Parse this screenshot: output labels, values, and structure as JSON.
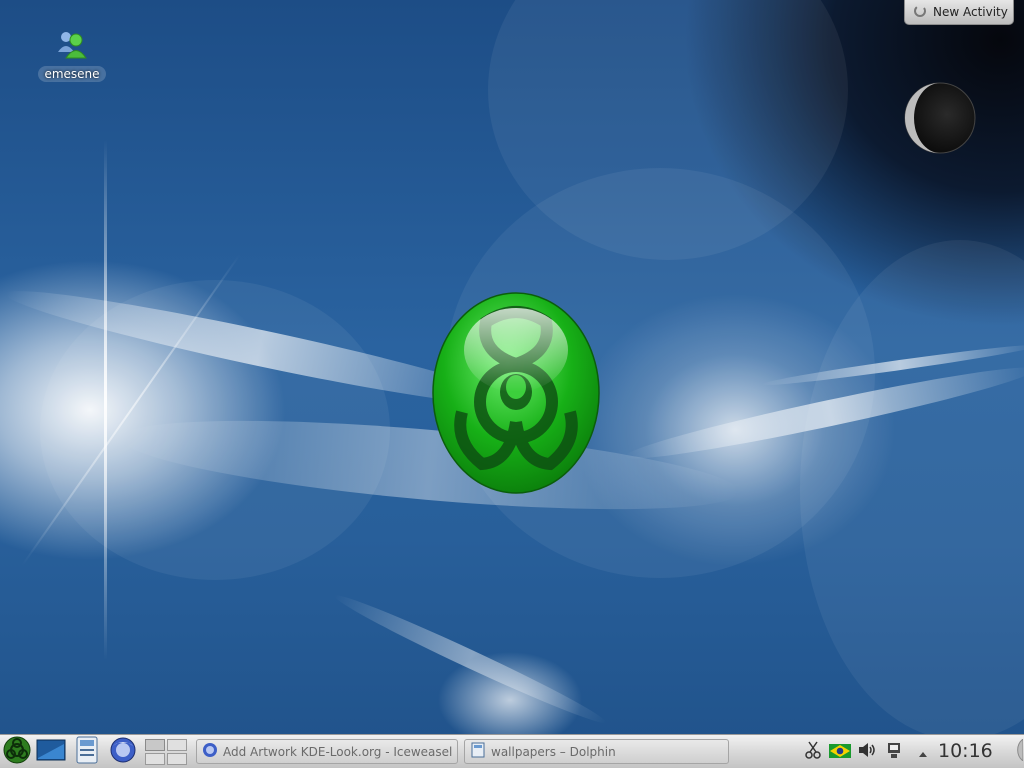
{
  "desktop": {
    "icons": [
      {
        "label": "emesene",
        "icon": "emesene-users-icon"
      }
    ]
  },
  "activity_button": {
    "label": "New Activity",
    "icon": "activity-spinner-icon"
  },
  "widgets": {
    "moon": "moon-phase-icon",
    "wallpaper_emblem": "biohazard-icon"
  },
  "panel": {
    "launcher_icons": [
      "kickoff-biohazard-icon",
      "desktop-icon",
      "file-manager-icon",
      "iceweasel-icon"
    ],
    "pager": {
      "desktops": 4
    },
    "tasks": [
      {
        "label": "Add  Artwork KDE-Look.org - Iceweasel",
        "icon": "iceweasel-icon"
      },
      {
        "label": "wallpapers – Dolphin",
        "icon": "dolphin-icon"
      }
    ],
    "tray": [
      "klipper-scissors-icon",
      "brazil-flag-icon",
      "volume-icon",
      "network-icon",
      "tray-expand-icon"
    ],
    "clock": "10:16"
  },
  "colors": {
    "wallpaper_blue": "#2a63a0",
    "panel": "#d9d9d9",
    "biohazard_green": "#1fb51f"
  }
}
